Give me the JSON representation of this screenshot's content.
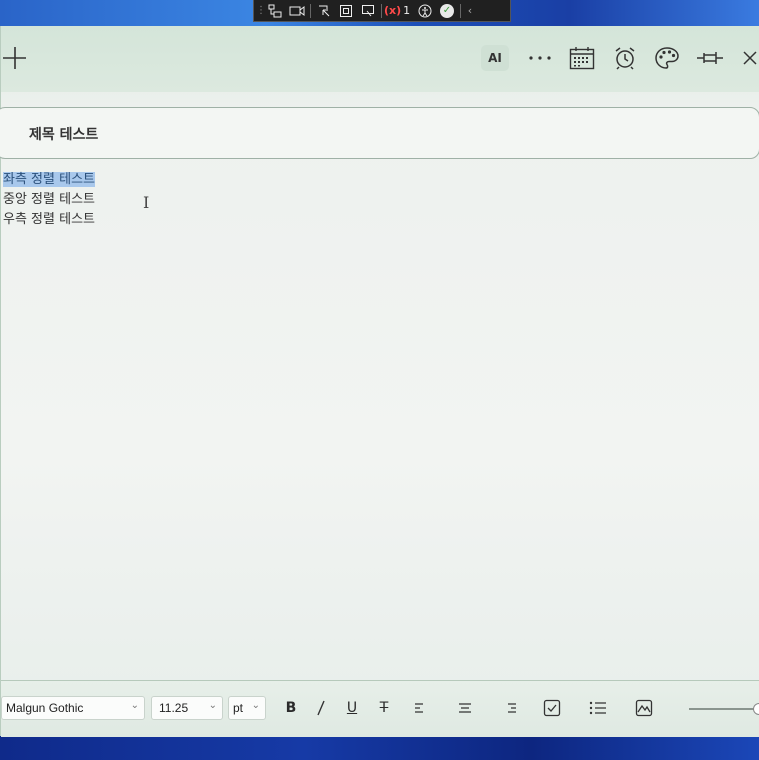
{
  "debug_toolbar": {
    "error_count": "1",
    "error_label": "(x)"
  },
  "titlebar": {
    "ai_label": "AI",
    "more_label": "···"
  },
  "note": {
    "title": "제목 테스트",
    "lines": [
      {
        "text": "좌측 정렬 테스트",
        "selected": true
      },
      {
        "text": "중앙 정렬 테스트",
        "selected": false
      },
      {
        "text": "우측 정렬 테스트",
        "selected": false
      }
    ]
  },
  "format_bar": {
    "font_family": "Malgun Gothic",
    "font_size": "11.25",
    "font_unit": "pt",
    "bold_label": "B",
    "italic_label": "/",
    "underline_label": "U",
    "strike_label": "T",
    "slider_value_percent": 100
  },
  "colors": {
    "accent_selection": "#a8c8ec",
    "titlebar": "#d4e5d9",
    "error": "#ff4a4a",
    "ok": "#3a9a3a"
  }
}
